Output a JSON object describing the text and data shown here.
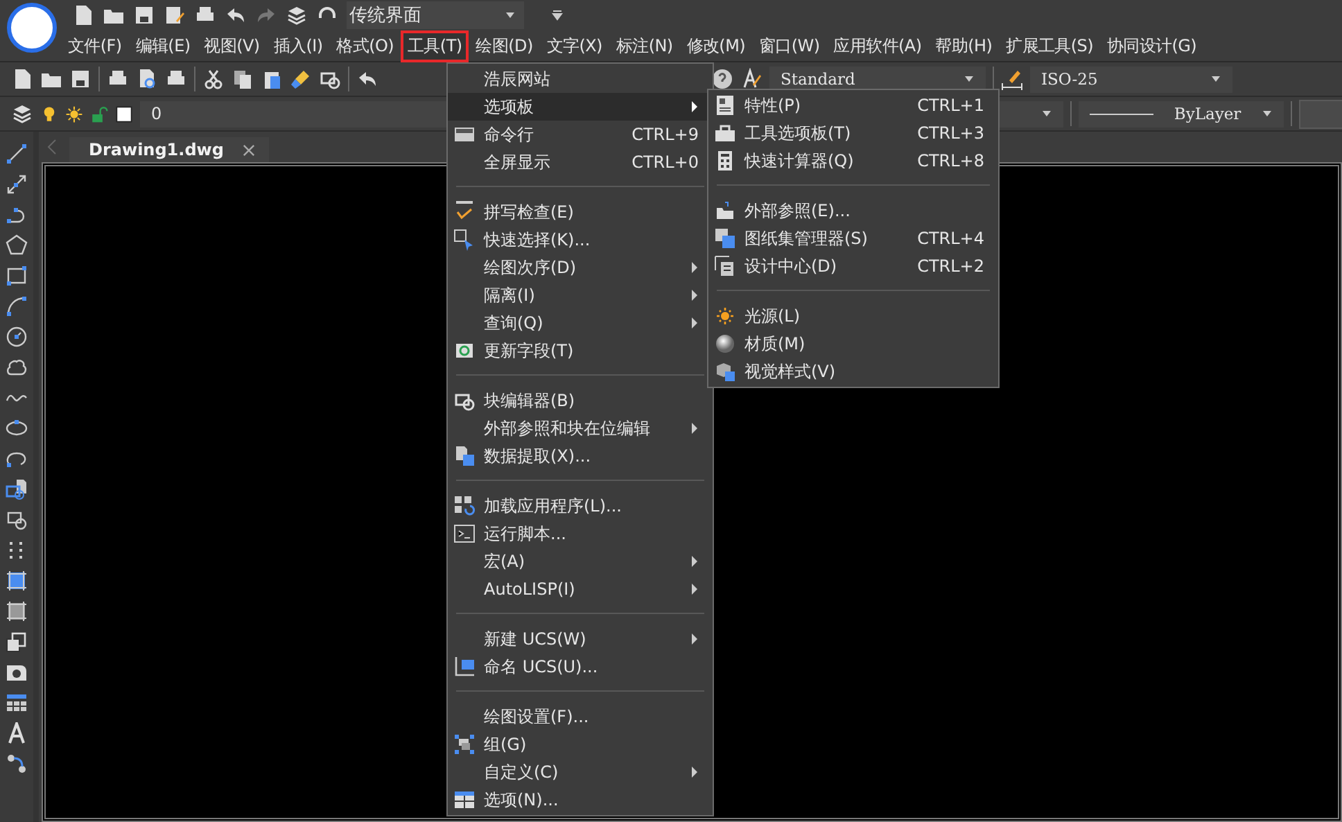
{
  "quick_access": {
    "workspace": "传统界面"
  },
  "menu_bar": [
    {
      "label": "文件(F)",
      "selected": false
    },
    {
      "label": "编辑(E)",
      "selected": false
    },
    {
      "label": "视图(V)",
      "selected": false
    },
    {
      "label": "插入(I)",
      "selected": false
    },
    {
      "label": "格式(O)",
      "selected": false
    },
    {
      "label": "工具(T)",
      "selected": true
    },
    {
      "label": "绘图(D)",
      "selected": false
    },
    {
      "label": "文字(X)",
      "selected": false
    },
    {
      "label": "标注(N)",
      "selected": false
    },
    {
      "label": "修改(M)",
      "selected": false
    },
    {
      "label": "窗口(W)",
      "selected": false
    },
    {
      "label": "应用软件(A)",
      "selected": false
    },
    {
      "label": "帮助(H)",
      "selected": false
    },
    {
      "label": "扩展工具(S)",
      "selected": false
    },
    {
      "label": "协同设计(G)",
      "selected": false
    }
  ],
  "styles_toolbar": {
    "text_style": "Standard",
    "dim_style": "ISO-25"
  },
  "layers_toolbar": {
    "layer": "0",
    "linetype": "ByLayer"
  },
  "document_tabs": [
    {
      "label": "Drawing1.dwg",
      "selected": true
    }
  ],
  "tools_menu": {
    "groups": [
      [
        {
          "label": "浩辰网站",
          "selected": false,
          "submenu": false
        },
        {
          "label": "选项板",
          "selected": true,
          "submenu": true
        },
        {
          "label": "命令行",
          "shortcut": "CTRL+9",
          "selected": false,
          "submenu": false
        },
        {
          "label": "全屏显示",
          "shortcut": "CTRL+0",
          "selected": false,
          "submenu": false
        }
      ],
      [
        {
          "label": "拼写检查(E)",
          "selected": false,
          "submenu": false
        },
        {
          "label": "快速选择(K)...",
          "selected": false,
          "submenu": false
        },
        {
          "label": "绘图次序(D)",
          "selected": false,
          "submenu": true
        },
        {
          "label": "隔离(I)",
          "selected": false,
          "submenu": true
        },
        {
          "label": "查询(Q)",
          "selected": false,
          "submenu": true
        },
        {
          "label": "更新字段(T)",
          "selected": false,
          "submenu": false
        }
      ],
      [
        {
          "label": "块编辑器(B)",
          "selected": false,
          "submenu": false
        },
        {
          "label": "外部参照和块在位编辑",
          "selected": false,
          "submenu": true
        },
        {
          "label": "数据提取(X)...",
          "selected": false,
          "submenu": false
        }
      ],
      [
        {
          "label": "加载应用程序(L)...",
          "selected": false,
          "submenu": false
        },
        {
          "label": "运行脚本...",
          "selected": false,
          "submenu": false
        },
        {
          "label": "宏(A)",
          "selected": false,
          "submenu": true
        },
        {
          "label": "AutoLISP(I)",
          "selected": false,
          "submenu": true
        }
      ],
      [
        {
          "label": "新建 UCS(W)",
          "selected": false,
          "submenu": true
        },
        {
          "label": "命名 UCS(U)...",
          "selected": false,
          "submenu": false
        }
      ],
      [
        {
          "label": "绘图设置(F)...",
          "selected": false,
          "submenu": false
        },
        {
          "label": "组(G)",
          "selected": false,
          "submenu": false
        },
        {
          "label": "自定义(C)",
          "selected": false,
          "submenu": true
        },
        {
          "label": "选项(N)...",
          "selected": false,
          "submenu": false
        }
      ]
    ]
  },
  "palettes_submenu": {
    "groups": [
      [
        {
          "label": "特性(P)",
          "shortcut": "CTRL+1"
        },
        {
          "label": "工具选项板(T)",
          "shortcut": "CTRL+3"
        },
        {
          "label": "快速计算器(Q)",
          "shortcut": "CTRL+8"
        }
      ],
      [
        {
          "label": "外部参照(E)..."
        },
        {
          "label": "图纸集管理器(S)",
          "shortcut": "CTRL+4"
        },
        {
          "label": "设计中心(D)",
          "shortcut": "CTRL+2"
        }
      ],
      [
        {
          "label": "光源(L)"
        },
        {
          "label": "材质(M)"
        },
        {
          "label": "视觉样式(V)"
        }
      ]
    ]
  }
}
